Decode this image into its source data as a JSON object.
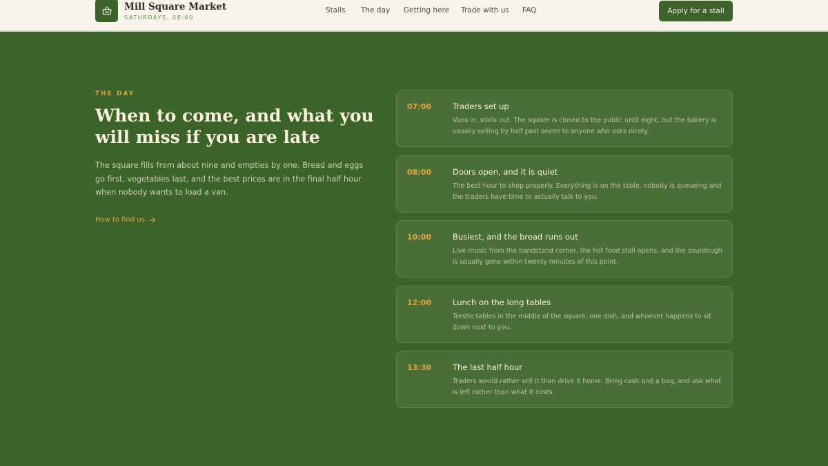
{
  "header": {
    "brand_name": "Mill Square Market",
    "brand_sub": "SATURDAYS, 08:00",
    "logo_icon": "basket-icon",
    "nav": [
      "Stalls",
      "The day",
      "Getting here",
      "Trade with us",
      "FAQ"
    ],
    "cta_label": "Apply for a stall"
  },
  "intro": {
    "eyebrow": "THE DAY",
    "headline": "When to come, and what you will miss if you are late",
    "body": "The square fills from about nine and empties by one. Bread and eggs go first, vegetables last, and the best prices are in the final half hour when nobody wants to load a van.",
    "link_label": "How to find us",
    "link_icon": "arrow-right-icon"
  },
  "timeline": [
    {
      "time": "07:00",
      "title": "Traders set up",
      "desc": "Vans in, stalls out. The square is closed to the public until eight, but the bakery is usually selling by half past seven to anyone who asks nicely."
    },
    {
      "time": "08:00",
      "title": "Doors open, and it is quiet",
      "desc": "The best hour to shop properly. Everything is on the table, nobody is queueing and the traders have time to actually talk to you."
    },
    {
      "time": "10:00",
      "title": "Busiest, and the bread runs out",
      "desc": "Live music from the bandstand corner, the hot food stall opens, and the sourdough is usually gone within twenty minutes of this point."
    },
    {
      "time": "12:00",
      "title": "Lunch on the long tables",
      "desc": "Trestle tables in the middle of the square, one dish, and whoever happens to sit down next to you."
    },
    {
      "time": "13:30",
      "title": "The last half hour",
      "desc": "Traders would rather sell it than drive it home. Bring cash and a bag, and ask what is left rather than what it costs."
    }
  ],
  "colors": {
    "background": "#3c632a",
    "header": "#f8f5ec",
    "accent": "#e0a43b",
    "card": "#4a6e37"
  }
}
